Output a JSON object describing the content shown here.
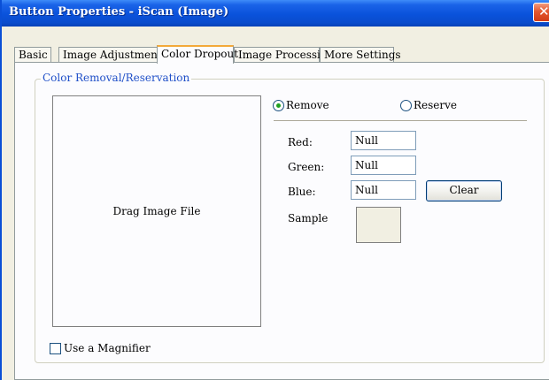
{
  "window": {
    "title": "Button Properties - iScan (Image)",
    "close_glyph": "✕"
  },
  "tabs": [
    {
      "label": "Basic",
      "active": false
    },
    {
      "label": "Image Adjustment",
      "active": false
    },
    {
      "label": "Color Dropout",
      "active": true
    },
    {
      "label": "Image Processing",
      "active": false
    },
    {
      "label": "More Settings",
      "active": false
    }
  ],
  "group": {
    "title": "Color Removal/Reservation"
  },
  "dropzone": {
    "label": "Drag Image File"
  },
  "magnifier": {
    "label": "Use a Magnifier",
    "checked": false
  },
  "mode": {
    "remove_label": "Remove",
    "reserve_label": "Reserve",
    "selected": "Remove"
  },
  "fields": {
    "red_label": "Red:",
    "red_value": "Null",
    "green_label": "Green:",
    "green_value": "Null",
    "blue_label": "Blue:",
    "blue_value": "Null",
    "sample_label": "Sample"
  },
  "buttons": {
    "clear_label": "Clear"
  },
  "colors": {
    "titlebar": "#0a52db",
    "active_tab_highlight": "#f3a93a",
    "group_title": "#2050c8",
    "radio_selected": "#21a121",
    "close_button": "#d23c16"
  }
}
